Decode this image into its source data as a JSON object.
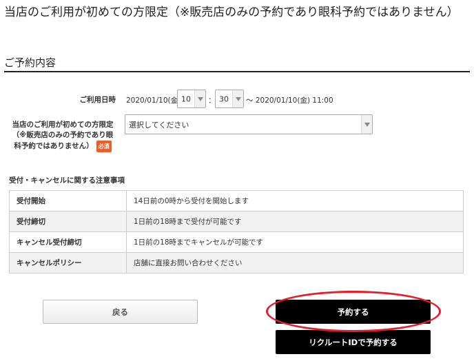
{
  "page": {
    "title": "当店のご利用が初めての方限定（※販売店のみの予約であり眼科予約ではありません）"
  },
  "section": {
    "title": "ご予約内容"
  },
  "form": {
    "date_label": "ご利用日時",
    "date_start": "2020/01/10(金)",
    "hour": "10",
    "time_separator": "：",
    "minute": "30",
    "date_end": "～ 2020/01/10(金) 11:00",
    "first_time_label": "当店のご利用が初めての方限定（※販売店のみの予約であり眼科予約ではありません）",
    "required_badge": "必須",
    "first_time_select": "選択してください"
  },
  "notice": {
    "title": "受付・キャンセルに関する注意事項",
    "rows": [
      {
        "key": "受付開始",
        "value": "14日前の0時から受付を開始します"
      },
      {
        "key": "受付締切",
        "value": "1日前の18時まで受付が可能です"
      },
      {
        "key": "キャンセル受付締切",
        "value": "1日前の18時までキャンセルが可能です"
      },
      {
        "key": "キャンセルポリシー",
        "value": "店舗に直接お問い合わせください"
      }
    ]
  },
  "buttons": {
    "back": "戻る",
    "reserve": "予約する",
    "recruit": "リクルートIDで予約する"
  },
  "colors": {
    "highlight": "#e61e2b",
    "required_badge": "#e8602c",
    "primary_button": "#000000"
  }
}
